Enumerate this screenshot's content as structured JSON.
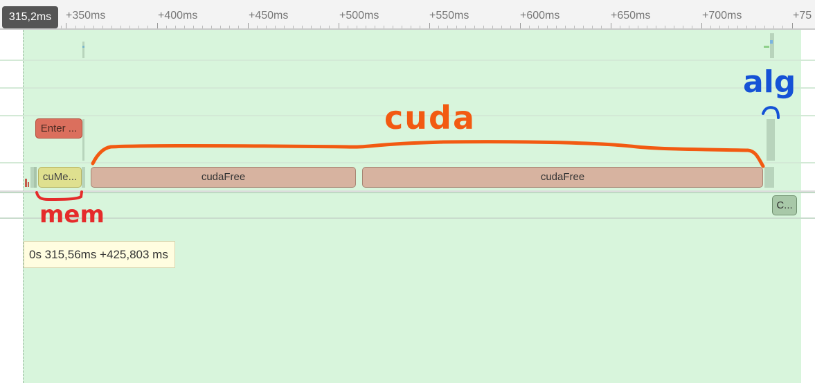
{
  "ruler": {
    "cursor_time": "315,2ms",
    "ticks": [
      "+350ms",
      "+400ms",
      "+450ms",
      "+500ms",
      "+550ms",
      "+600ms",
      "+650ms",
      "+700ms",
      "+75"
    ]
  },
  "slices": {
    "enter": "Enter ...",
    "cume": "cuMe...",
    "cudafree_1": "cudaFree",
    "cudafree_2": "cudaFree",
    "c": "C..."
  },
  "tooltip": {
    "text": "0s 315,56ms +425,803 ms"
  },
  "annotations": {
    "cuda": "cuda",
    "mem": "mem",
    "alg": "alg"
  },
  "colors": {
    "selection": "#d8f5dc",
    "cuda_annotation": "#f25a12",
    "mem_annotation": "#e52b2b",
    "alg_annotation": "#1552d6"
  }
}
